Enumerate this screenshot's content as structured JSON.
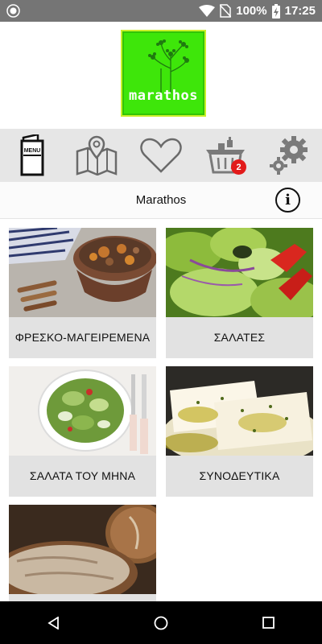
{
  "status_bar": {
    "battery": "100%",
    "time": "17:25"
  },
  "logo": {
    "text": "marathos",
    "background_color": "#3ee60a"
  },
  "toolbar": {
    "items": [
      {
        "name": "menu",
        "icon": "menu-book-icon",
        "icon_text": "MENU"
      },
      {
        "name": "map",
        "icon": "map-pin-icon"
      },
      {
        "name": "favorites",
        "icon": "heart-icon"
      },
      {
        "name": "cart",
        "icon": "basket-icon",
        "badge": "2"
      },
      {
        "name": "settings",
        "icon": "gears-icon"
      }
    ],
    "badge_color": "#e21a1a"
  },
  "header": {
    "title": "Marathos",
    "info_icon": "i"
  },
  "categories": [
    {
      "label": "ΦΡΕΣΚΟ-ΜΑΓΕΙΡΕΜΕΝΑ",
      "image": "stew-pot-photo"
    },
    {
      "label": "ΣΑΛΑΤΕΣ",
      "image": "green-salad-photo"
    },
    {
      "label": "ΣΑΛΑΤΑ ΤΟΥ ΜΗΝΑ",
      "image": "salad-bowl-photo"
    },
    {
      "label": "ΣΥΝΟΔΕΥΤΙΚΑ",
      "image": "feta-cheese-photo"
    },
    {
      "label": "",
      "image": "bread-loaf-photo"
    }
  ],
  "nav": {
    "back": "back-triangle-icon",
    "home": "home-circle-icon",
    "recents": "recents-square-icon"
  }
}
